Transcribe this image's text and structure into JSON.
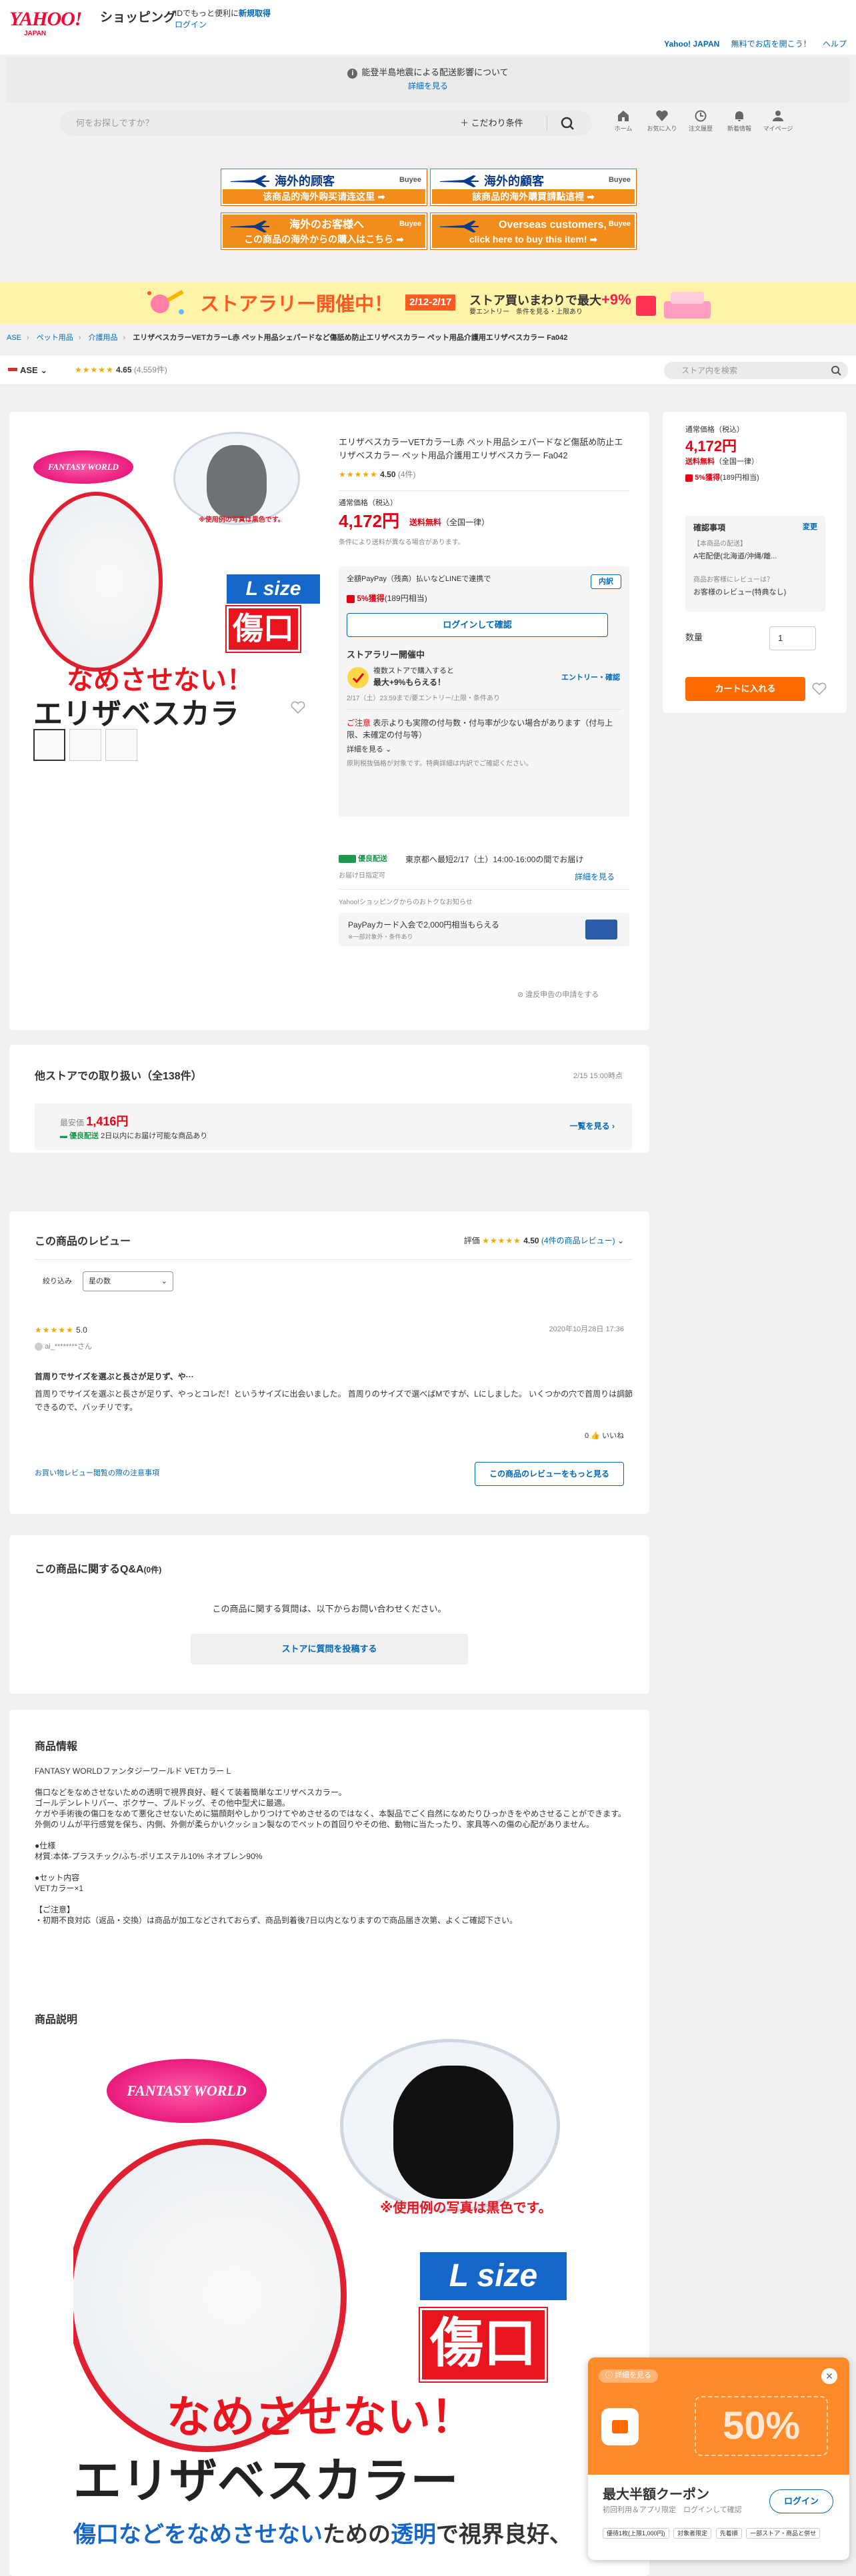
{
  "header": {
    "logo_text": "YAHOO!",
    "logo_sub": "JAPAN",
    "service": "ショッピング",
    "id_promo": "IDでもっと便利に",
    "signup": "新規取得",
    "login": "ログイン",
    "links": [
      "Yahoo! JAPAN",
      "無料でお店を開こう！",
      "ヘルプ"
    ]
  },
  "notice": {
    "text": "能登半島地震による配送影響について",
    "link": "詳細を見る"
  },
  "search": {
    "placeholder": "何をお探しですか？",
    "conditions": "こだわり条件"
  },
  "nav_icons": [
    {
      "icon": "home-icon",
      "label": "ホーム"
    },
    {
      "icon": "heart-icon",
      "label": "お気に入り"
    },
    {
      "icon": "history-icon",
      "label": "注文履歴"
    },
    {
      "icon": "bell-icon",
      "label": "新着情報"
    },
    {
      "icon": "user-icon",
      "label": "マイページ"
    }
  ],
  "banners": [
    {
      "title": "海外的顾客",
      "sub": "该商品的海外购买请连这里 ➡",
      "brand": "Buyee"
    },
    {
      "title": "海外的顧客",
      "sub": "該商品的海外購買請點這裡 ➡",
      "brand": "Buyee"
    },
    {
      "title": "海外のお客様へ",
      "sub": "この商品の海外からの購入はこちら ➡",
      "brand": "Buyee"
    },
    {
      "title": "Overseas customers,",
      "sub": "click here to buy this item! ➡",
      "brand": "Buyee"
    }
  ],
  "rally": {
    "title": "ストアラリー開催中！",
    "dates": "2/12-2/17",
    "promo": "ストア買いまわりで最大",
    "rate": "+9%",
    "entry": "要エントリー　条件を見る・上限あり"
  },
  "breadcrumb": [
    "ASE",
    "ペット用品",
    "介護用品",
    "エリザベスカラーVETカラーL赤 ペット用品シェパードなど傷舐め防止エリザベスカラー ペット用品介護用エリザベスカラー Fa042"
  ],
  "store": {
    "name": "ASE",
    "rating": "4.65",
    "count": "(4,559件)",
    "search_placeholder": "ストア内を検索"
  },
  "product": {
    "title": "エリザベスカラーVETカラーL赤 ペット用品シェパードなど傷舐め防止エリザベスカラー ペット用品介護用エリザベスカラー Fa042",
    "rating": "4.50",
    "review_count": "(4件)",
    "price_label": "通常価格（税込）",
    "price": "4,172円",
    "shipping": "送料無料",
    "shipping_note": "（全国一律）",
    "shipping_sub": "条件により送料が異なる場合があります。",
    "paypay_note": "全額PayPay（残高）払いなどLINEで連携で",
    "paypay_link": "内訳",
    "points": "5%獲得",
    "points_sub": "(189円相当)",
    "login_button": "ログインして確認",
    "rally_title": "ストアラリー開催中",
    "rally_line1": "複数ストアで購入すると",
    "rally_line2": "最大+9%もらえる！",
    "rally_entry": "エントリー・確認",
    "rally_period": "2/17（土）23:59まで/要エントリー/上限・条件あり",
    "caution_label": "ご注意",
    "caution": "表示よりも実際の付与数・付与率が少ない場合があります（付与上限、未確定の付与等）",
    "details": "詳細を見る",
    "caution_sub": "原則税抜価格が対象です。特典詳細は内訳でご確認ください。",
    "delivery_badge": "優良配送",
    "delivery": "東京都へ最短2/17（土）14:00-16:00の間でお届け",
    "delivery_sub": "お届け日指定可",
    "delivery_link": "詳細を見る",
    "offer_head": "Yahoo!ショッピングからのおトクなお知らせ",
    "offer": "PayPayカード入会で2,000円相当もらえる",
    "offer_sub": "※一部対象外・条件あり",
    "report": "違反申告の申請をする",
    "image_text": {
      "brand": "FANTASY WORLD",
      "size": "L size",
      "wound": "傷口",
      "lick": "なめさせない！",
      "collar": "エリザベスカラ",
      "note": "※使用例の写真は黒色です。"
    }
  },
  "buybox": {
    "price_label": "通常価格（税込）",
    "price": "4,172円",
    "shipping": "送料無料",
    "shipping_note": "（全国一律）",
    "points": "5%獲得",
    "points_sub": "(189円相当)",
    "confirm_title": "確認事項",
    "change": "変更",
    "option_label": "【本商品の配送】",
    "option_value": "A宅配便(北海道/沖縄/離...",
    "review_q": "商品お客様にレビューは？",
    "review_a": "お客様のレビュー(特典なし)",
    "qty_label": "数量",
    "qty": "1",
    "cart": "カートに入れる"
  },
  "other_stores": {
    "title": "他ストアでの取り扱い（全138件）",
    "time": "2/15 15:00時点",
    "min_label": "最安価",
    "min_price": "1,416円",
    "badge": "優良配送",
    "badge_note": "2日以内にお届け可能な商品あり",
    "link": "一覧を見る"
  },
  "reviews": {
    "title": "この商品のレビュー",
    "rating_label": "評価",
    "rating": "4.50",
    "count_link": "(4件の商品レビュー)",
    "filter_label": "絞り込み",
    "filter_value": "星の数",
    "item_score": "5.0",
    "item_date": "2020年10月28日 17:36",
    "item_user": "ai_********さん",
    "item_title": "首周りでサイズを選ぶと長さが足りず、や···",
    "item_body": "首周りでサイズを選ぶと長さが足りず、やっとコレだ！というサイズに出会いました。 首周りのサイズで選べばMですが、Lにしました。 いくつかの穴で首周りは調節できるので、バッチリです。",
    "like_count": "0",
    "like": "いいね",
    "note_link": "お買い物レビュー閲覧の際の注意事項",
    "more": "この商品のレビューをもっと見る"
  },
  "qa": {
    "title": "この商品に関するQ&A",
    "count": "(0件)",
    "text": "この商品に関する質問は、以下からお問い合わせください。",
    "button": "ストアに質問を投稿する"
  },
  "product_info": {
    "title": "商品情報",
    "lines": [
      "FANTASY WORLDファンタジーワールド VETカラー L",
      "",
      "傷口などをなめさせないための透明で視界良好、軽くて装着簡単なエリザベスカラー。",
      "ゴールデンレトリバー、ボクサー、ブルドッグ、その他中型犬に最適。",
      "ケガや手術後の傷口をなめて悪化させないために猫顔剤やしかりつけてやめさせるのではなく、本製品でごく自然になめたりひっかきをやめさせることができます。",
      "外側のリムが平行感覚を保ち、内側、外側が柔らかいクッション製なのでペットの首回りやその他、動物に当たったり、家具等への傷の心配がありません。",
      "",
      "●仕様",
      "材質:本体-プラスチック/ふち-ポリエステル10% ネオプレン90%",
      "",
      "●セット内容",
      "VETカラー×1",
      "",
      "【ご注意】",
      "・初期不良対応（返品・交換）は商品が加工などされておらず、商品到着後7日以内となりますので商品届き次第、よくご確認下さい。"
    ],
    "desc_title": "商品説明",
    "desc_image_text": {
      "brand": "FANTASY WORLD",
      "size": "L size",
      "wound": "傷口",
      "lick": "なめさせない！",
      "collar": "エリザベスカラー",
      "note": "※使用例の写真は黒色です。",
      "bottom_blue": "傷口などをなめさせない",
      "bottom_black": "ための",
      "bottom_blue2": "透明",
      "bottom_black2": "で視界良好、"
    }
  },
  "coupon": {
    "badge": "詳細を見る",
    "percent": "50%",
    "title": "最大半額クーポン",
    "sub": "初回利用＆アプリ限定　ログインして確認",
    "login": "ログイン",
    "tags": [
      "優待1枚(上限1,000円)",
      "対象者限定",
      "先着順",
      "一部ストア・商品と併せ"
    ]
  },
  "colors": {
    "accent_red": "#e60012",
    "link_blue": "#0068b7",
    "cart_orange": "#ff6a00",
    "star": "#f6a800"
  }
}
